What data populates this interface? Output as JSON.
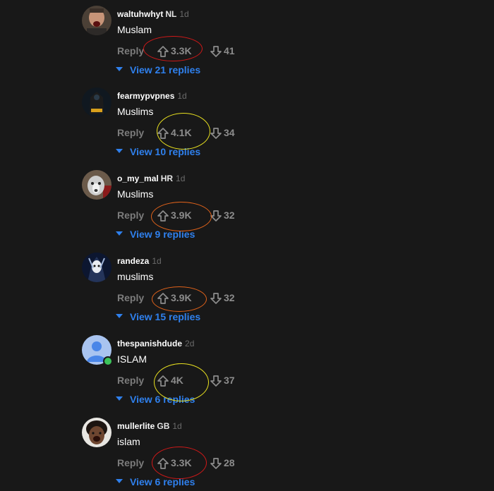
{
  "comments": [
    {
      "username": "waltuhwhyt",
      "flag": "NL",
      "time": "1d",
      "text": "Muslam",
      "reply_label": "Reply",
      "upvotes": "3.3K",
      "downvotes": "41",
      "replies_label": "View 21 replies",
      "circle_color": "#d01818"
    },
    {
      "username": "fearmypvpnes",
      "flag": "",
      "time": "1d",
      "text": "Muslims",
      "reply_label": "Reply",
      "upvotes": "4.1K",
      "downvotes": "34",
      "replies_label": "View 10 replies",
      "circle_color": "#e8e020"
    },
    {
      "username": "o_my_mal",
      "flag": "HR",
      "time": "1d",
      "text": "Muslims",
      "reply_label": "Reply",
      "upvotes": "3.9K",
      "downvotes": "32",
      "replies_label": "View 9 replies",
      "circle_color": "#e0621a"
    },
    {
      "username": "randeza",
      "flag": "",
      "time": "1d",
      "text": "muslims",
      "reply_label": "Reply",
      "upvotes": "3.9K",
      "downvotes": "32",
      "replies_label": "View 15 replies",
      "circle_color": "#e0621a"
    },
    {
      "username": "thespanishdude",
      "flag": "",
      "time": "2d",
      "text": "ISLAM",
      "reply_label": "Reply",
      "upvotes": "4K",
      "downvotes": "37",
      "replies_label": "View 6 replies",
      "circle_color": "#e8e020"
    },
    {
      "username": "mullerlite",
      "flag": "GB",
      "time": "1d",
      "text": "islam",
      "reply_label": "Reply",
      "upvotes": "3.3K",
      "downvotes": "28",
      "replies_label": "View 6 replies",
      "circle_color": "#d01818"
    }
  ],
  "icons": {
    "upvote": "arrow-up-outline-icon",
    "downvote": "arrow-down-outline-icon",
    "expand": "caret-down-icon"
  },
  "colors": {
    "background": "#181818",
    "link_blue": "#2f80ed",
    "online": "#3cc35a"
  }
}
